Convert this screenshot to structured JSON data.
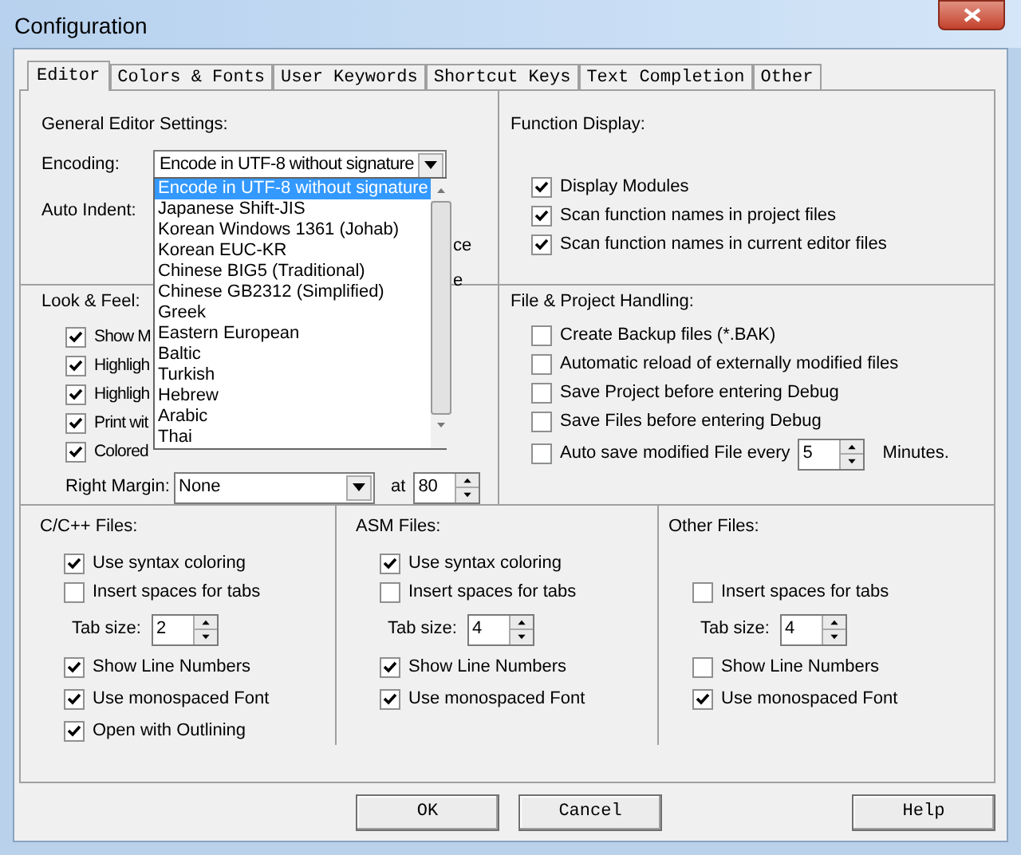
{
  "window": {
    "title": "Configuration"
  },
  "tabs": [
    {
      "label": "Editor",
      "selected": true
    },
    {
      "label": "Colors & Fonts",
      "selected": false
    },
    {
      "label": "User Keywords",
      "selected": false
    },
    {
      "label": "Shortcut Keys",
      "selected": false
    },
    {
      "label": "Text Completion",
      "selected": false
    },
    {
      "label": "Other",
      "selected": false
    }
  ],
  "general_editor_settings": {
    "title": "General Editor Settings:",
    "encoding": {
      "label": "Encoding:",
      "value": "Encode in UTF-8 without signature",
      "expanded": true,
      "options": [
        {
          "label": "Encode in UTF-8 without signature",
          "selected": true
        },
        {
          "label": "Japanese Shift-JIS",
          "selected": false
        },
        {
          "label": "Korean Windows 1361 (Johab)",
          "selected": false
        },
        {
          "label": "Korean EUC-KR",
          "selected": false
        },
        {
          "label": "Chinese BIG5 (Traditional)",
          "selected": false
        },
        {
          "label": "Chinese GB2312 (Simplified)",
          "selected": false
        },
        {
          "label": "Greek",
          "selected": false
        },
        {
          "label": "Eastern European",
          "selected": false
        },
        {
          "label": "Baltic",
          "selected": false
        },
        {
          "label": "Turkish",
          "selected": false
        },
        {
          "label": "Hebrew",
          "selected": false
        },
        {
          "label": "Arabic",
          "selected": false
        },
        {
          "label": "Thai",
          "selected": false
        }
      ]
    },
    "auto_indent": {
      "label": "Auto Indent:"
    },
    "covered_labels": [
      "ce",
      "e"
    ]
  },
  "function_display": {
    "title": "Function Display:",
    "checkboxes": [
      {
        "label": "Display Modules",
        "checked": true
      },
      {
        "label": "Scan function names in project files",
        "checked": true
      },
      {
        "label": "Scan function names in current editor files",
        "checked": true
      }
    ]
  },
  "look_and_feel": {
    "title": "Look & Feel:",
    "checkboxes": [
      {
        "label": "Show M",
        "checked": true
      },
      {
        "label": "Highligh",
        "checked": true
      },
      {
        "label": "Highligh",
        "checked": true
      },
      {
        "label": "Print wit",
        "checked": true
      },
      {
        "label": "Colored",
        "checked": true
      }
    ],
    "right_margin": {
      "label": "Right Margin:",
      "value": "None",
      "at_label": "at",
      "at_value": "80"
    }
  },
  "file_project_handling": {
    "title": "File & Project Handling:",
    "checkboxes": [
      {
        "label": "Create Backup files (*.BAK)",
        "checked": false
      },
      {
        "label": "Automatic reload of externally modified files",
        "checked": false
      },
      {
        "label": "Save Project before entering Debug",
        "checked": false
      },
      {
        "label": "Save Files before entering Debug",
        "checked": false
      }
    ],
    "auto_save": {
      "label": "Auto save modified File every",
      "checked": false,
      "value": "5",
      "suffix": "Minutes."
    }
  },
  "file_types": [
    {
      "title": "C/C++ Files:",
      "items": [
        {
          "kind": "checkbox",
          "label": "Use syntax coloring",
          "checked": true
        },
        {
          "kind": "checkbox",
          "label": "Insert spaces for tabs",
          "checked": false
        },
        {
          "kind": "tab_size",
          "label": "Tab size:",
          "value": "2"
        },
        {
          "kind": "checkbox",
          "label": "Show Line Numbers",
          "checked": true
        },
        {
          "kind": "checkbox",
          "label": "Use monospaced Font",
          "checked": true
        },
        {
          "kind": "checkbox",
          "label": "Open with Outlining",
          "checked": true
        }
      ]
    },
    {
      "title": "ASM Files:",
      "items": [
        {
          "kind": "checkbox",
          "label": "Use syntax coloring",
          "checked": true
        },
        {
          "kind": "checkbox",
          "label": "Insert spaces for tabs",
          "checked": false
        },
        {
          "kind": "tab_size",
          "label": "Tab size:",
          "value": "4"
        },
        {
          "kind": "checkbox",
          "label": "Show Line Numbers",
          "checked": true
        },
        {
          "kind": "checkbox",
          "label": "Use monospaced Font",
          "checked": true
        }
      ]
    },
    {
      "title": "Other Files:",
      "items": [
        {
          "kind": "blank"
        },
        {
          "kind": "checkbox",
          "label": "Insert spaces for tabs",
          "checked": false
        },
        {
          "kind": "tab_size",
          "label": "Tab size:",
          "value": "4"
        },
        {
          "kind": "checkbox",
          "label": "Show Line Numbers",
          "checked": false
        },
        {
          "kind": "checkbox",
          "label": "Use monospaced Font",
          "checked": true
        }
      ]
    }
  ],
  "buttons": [
    {
      "label": "OK"
    },
    {
      "label": "Cancel"
    },
    {
      "label": "Help"
    }
  ]
}
